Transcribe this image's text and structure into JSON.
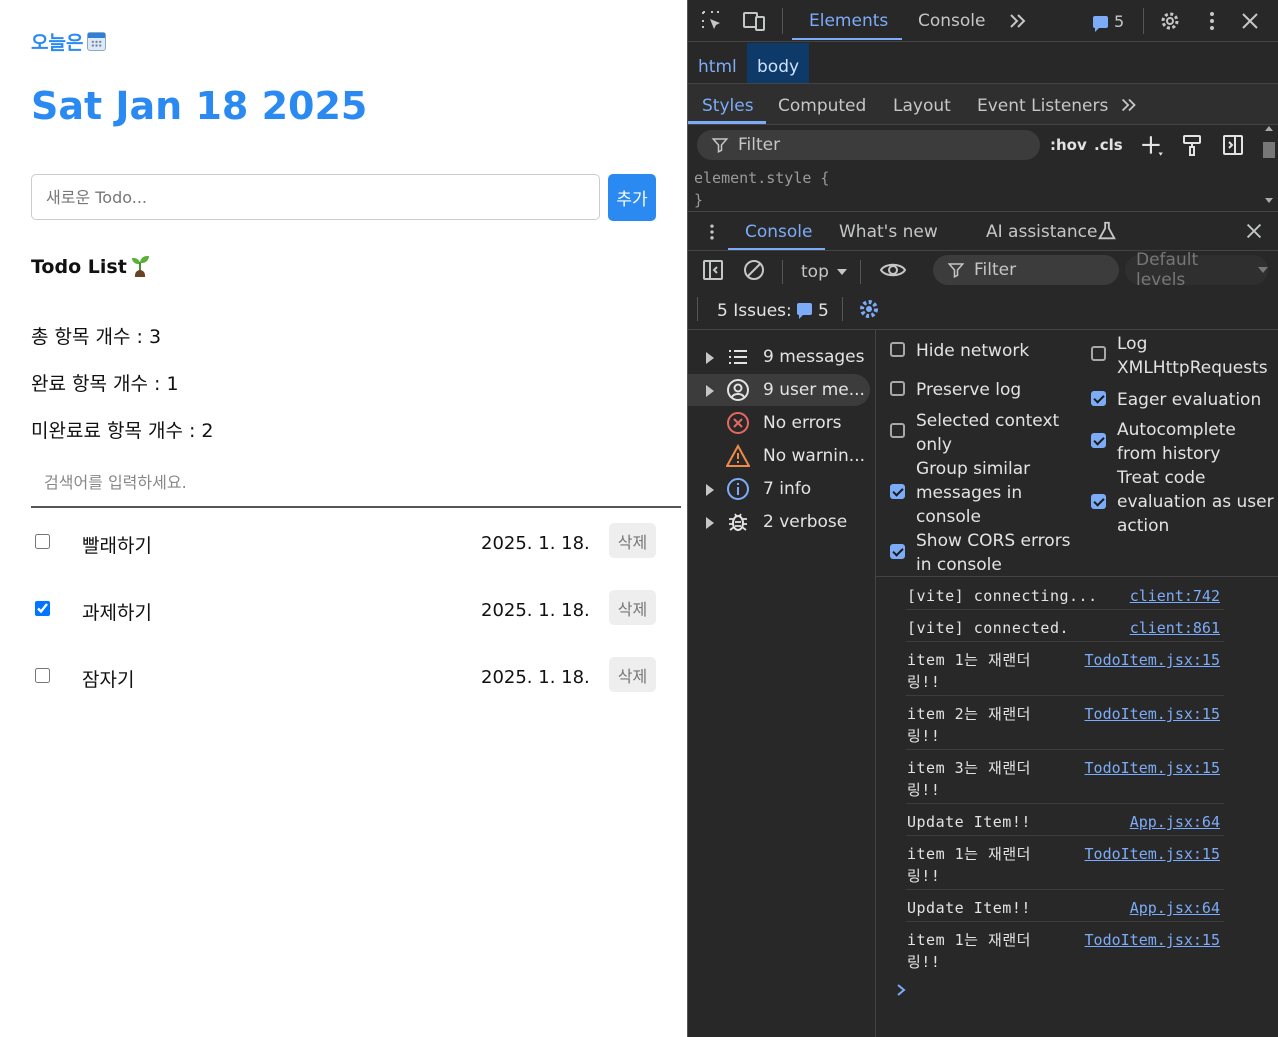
{
  "app": {
    "today_label": "오늘은",
    "date_title": "Sat Jan 18 2025",
    "new_todo_placeholder": "새로운 Todo...",
    "add_button": "추가",
    "list_heading": "Todo List",
    "stats": {
      "total": "총 항목 개수 : 3",
      "done": "완료 항목 개수 : 1",
      "undone": "미완료료 항목 개수 : 2"
    },
    "search_placeholder": "검색어를 입력하세요.",
    "todos": [
      {
        "content": "빨래하기",
        "date": "2025. 1. 18.",
        "done": false,
        "delete_label": "삭제"
      },
      {
        "content": "과제하기",
        "date": "2025. 1. 18.",
        "done": true,
        "delete_label": "삭제"
      },
      {
        "content": "잠자기",
        "date": "2025. 1. 18.",
        "done": false,
        "delete_label": "삭제"
      }
    ]
  },
  "devtools": {
    "tabs": [
      "Elements",
      "Console"
    ],
    "active_tab": "Elements",
    "issues_count": "5",
    "breadcrumb": [
      "html",
      "body"
    ],
    "styles_tabs": [
      "Styles",
      "Computed",
      "Layout",
      "Event Listeners"
    ],
    "filter_placeholder": "Filter",
    "hov_label": ":hov",
    "cls_label": ".cls",
    "element_style_open": "element.style {",
    "element_style_close": "}",
    "drawer_tabs": [
      "Console",
      "What's new",
      "AI assistance"
    ],
    "context": "top",
    "console_filter": "Filter",
    "default_levels": "Default levels",
    "issues_label": "5 Issues:",
    "issues_badge_count": "5",
    "sidebar": [
      {
        "label": "9 messages",
        "icon": "list-icon",
        "expandable": true
      },
      {
        "label": "9 user me...",
        "icon": "user-icon",
        "expandable": true,
        "selected": true
      },
      {
        "label": "No errors",
        "icon": "error-icon",
        "expandable": false
      },
      {
        "label": "No warnin...",
        "icon": "warning-icon",
        "expandable": false
      },
      {
        "label": "7 info",
        "icon": "info-icon",
        "expandable": true
      },
      {
        "label": "2 verbose",
        "icon": "bug-icon",
        "expandable": true
      }
    ],
    "settings_left": [
      {
        "label": "Hide network",
        "checked": false
      },
      {
        "label": "Preserve log",
        "checked": false
      },
      {
        "label": "Selected context only",
        "checked": false
      },
      {
        "label": "Group similar messages in console",
        "checked": true
      },
      {
        "label": "Show CORS errors in console",
        "checked": true
      }
    ],
    "settings_right": [
      {
        "label": "Log XMLHttpRequests",
        "checked": false
      },
      {
        "label": "Eager evaluation",
        "checked": true
      },
      {
        "label": "Autocomplete from history",
        "checked": true
      },
      {
        "label": "Treat code evaluation as user action",
        "checked": true
      }
    ],
    "logs": [
      {
        "message": "[vite] connecting...",
        "source": "client:742"
      },
      {
        "message": "[vite] connected.",
        "source": "client:861"
      },
      {
        "message": "item 1는 재랜더\n링!!",
        "source": "TodoItem.jsx:15"
      },
      {
        "message": "item 2는 재랜더\n링!!",
        "source": "TodoItem.jsx:15"
      },
      {
        "message": "item 3는 재랜더\n링!!",
        "source": "TodoItem.jsx:15"
      },
      {
        "message": "Update Item!!",
        "source": "App.jsx:64"
      },
      {
        "message": "item 1는 재랜더\n링!!",
        "source": "TodoItem.jsx:15"
      },
      {
        "message": "Update Item!!",
        "source": "App.jsx:64"
      },
      {
        "message": "item 1는 재랜더\n링!!",
        "source": "TodoItem.jsx:15"
      }
    ],
    "colors": {
      "accent": "#7cacf8",
      "panel_bg": "#282828",
      "app_accent": "#2b8af2"
    }
  }
}
